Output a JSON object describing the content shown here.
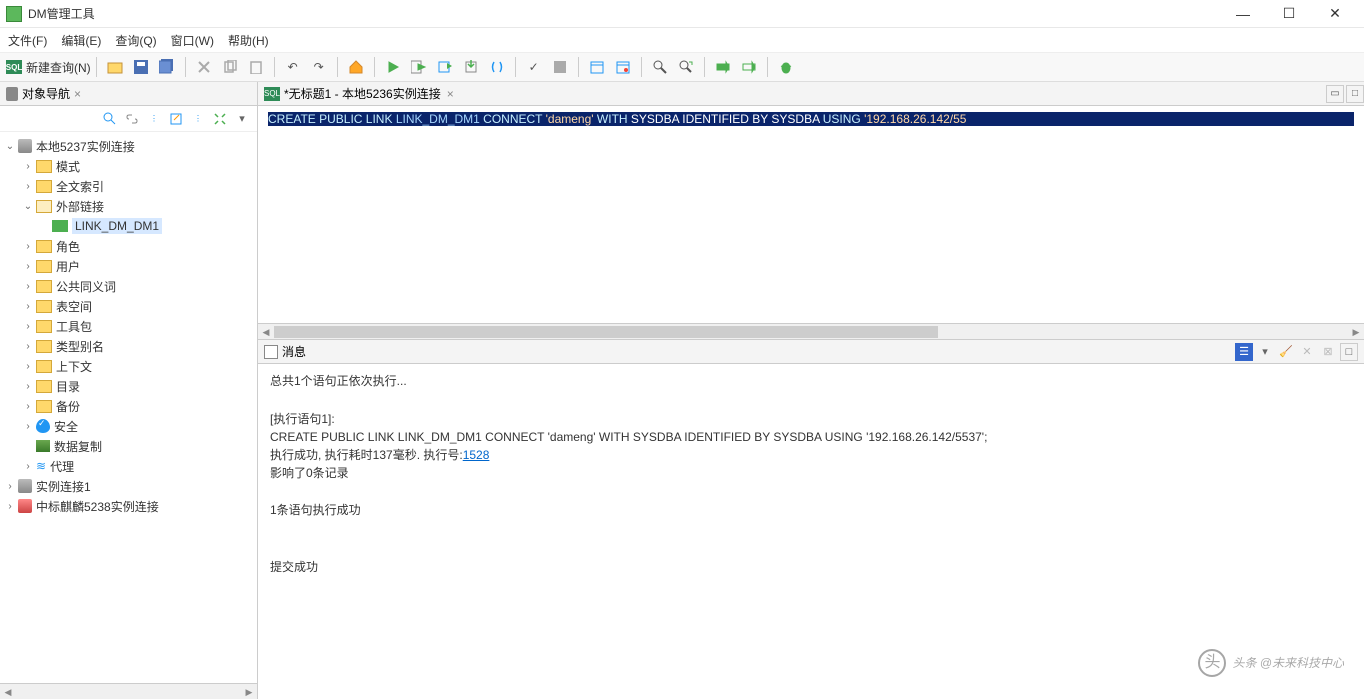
{
  "app": {
    "title": "DM管理工具"
  },
  "menu": [
    "文件(F)",
    "编辑(E)",
    "查询(Q)",
    "窗口(W)",
    "帮助(H)"
  ],
  "toolbar": {
    "new_query": "新建查询(N)"
  },
  "sidebar": {
    "tab": "对象导航",
    "tree": {
      "root": "本地5237实例连接",
      "items": [
        "模式",
        "全文索引"
      ],
      "external_links": {
        "label": "外部链接",
        "children": [
          "LINK_DM_DM1"
        ]
      },
      "items2": [
        "角色",
        "用户",
        "公共同义词",
        "表空间",
        "工具包",
        "类型别名",
        "上下文",
        "目录",
        "备份"
      ],
      "security": "安全",
      "replication": "数据复制",
      "agent": "代理",
      "conn2": "实例连接1",
      "conn3": "中标麒麟5238实例连接"
    }
  },
  "editor": {
    "tab": "*无标题1 - 本地5236实例连接",
    "sql_parts": {
      "p1": "CREATE PUBLIC LINK ",
      "p2": "LINK_DM_DM1 ",
      "p3": "CONNECT ",
      "p4": "'dameng' ",
      "p5": "WITH ",
      "p6": "SYSDBA IDENTIFIED BY SYSDBA ",
      "p7": "USING ",
      "p8": "'192.168.26.142/55"
    }
  },
  "messages": {
    "tab": "消息",
    "l1": "总共1个语句正依次执行...",
    "l2": "[执行语句1]:",
    "l3": "CREATE PUBLIC LINK LINK_DM_DM1 CONNECT 'dameng' WITH SYSDBA IDENTIFIED BY SYSDBA USING '192.168.26.142/5537';",
    "l4a": "执行成功, 执行耗时137毫秒. 执行号:",
    "l4b": "1528",
    "l5": "影响了0条记录",
    "l6": "1条语句执行成功",
    "l7": "提交成功"
  },
  "watermark": {
    "main": "头条 @未来科技中心"
  }
}
